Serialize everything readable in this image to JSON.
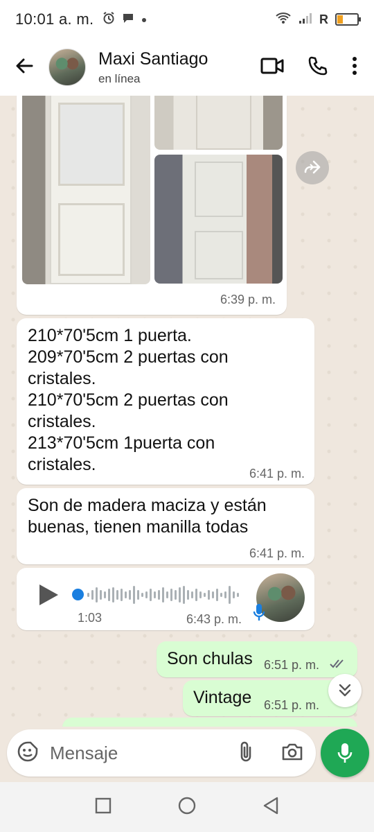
{
  "status_bar": {
    "time": "10:01 a. m.",
    "network_letter": "R"
  },
  "header": {
    "contact_name": "Maxi Santiago",
    "contact_status": "en línea"
  },
  "messages": {
    "photo_album_time": "6:39 p. m.",
    "text1": "210*70'5cm 1 puerta.\n209*70'5cm 2 puertas con cristales.\n210*70'5cm 2 puertas con cristales.\n213*70'5cm 1puerta con cristales.",
    "text1_time": "6:41 p. m.",
    "text2": "Son de madera maciza y están buenas, tienen manilla todas",
    "text2_time": "6:41 p. m.",
    "voice_duration": "1:03",
    "voice_time": "6:43 p. m.",
    "out1": "Son chulas",
    "out1_time": "6:51 p. m.",
    "out2": "Vintage",
    "out2_time": "6:51 p. m."
  },
  "input": {
    "placeholder": "Mensaje"
  },
  "icons": {
    "back": "arrow-left-icon",
    "video": "video-call-icon",
    "phone": "phone-icon",
    "menu": "more-vert-icon",
    "emoji": "sticker-icon",
    "attach": "paperclip-icon",
    "camera": "camera-icon",
    "mic": "mic-icon"
  },
  "colors": {
    "accent": "#1fa855",
    "outgoing_bubble": "#d9fdd3",
    "incoming_bubble": "#ffffff",
    "read_ticks": "#53bdeb"
  }
}
